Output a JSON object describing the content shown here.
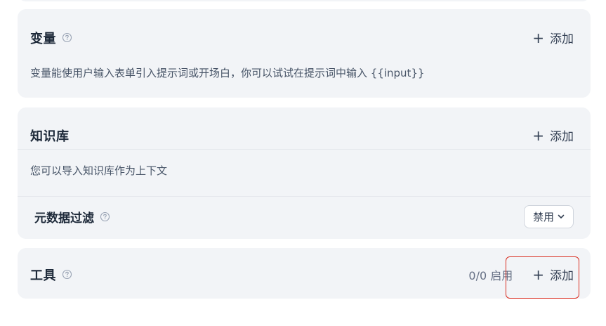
{
  "variables": {
    "title": "变量",
    "add_label": "添加",
    "description": "变量能使用户输入表单引入提示词或开场白，你可以试试在提示词中输入 {{input}}"
  },
  "knowledge": {
    "title": "知识库",
    "add_label": "添加",
    "description": "您可以导入知识库作为上下文",
    "metadata_filter": {
      "title": "元数据过滤",
      "selected": "禁用"
    }
  },
  "tools": {
    "title": "工具",
    "status": "0/0 启用",
    "add_label": "添加"
  },
  "icons": {
    "help": "help-circle-icon",
    "add": "plus-icon",
    "dropdown": "chevron-down-icon"
  },
  "colors": {
    "card_bg": "#f2f4f7",
    "highlight": "#d92d20"
  }
}
